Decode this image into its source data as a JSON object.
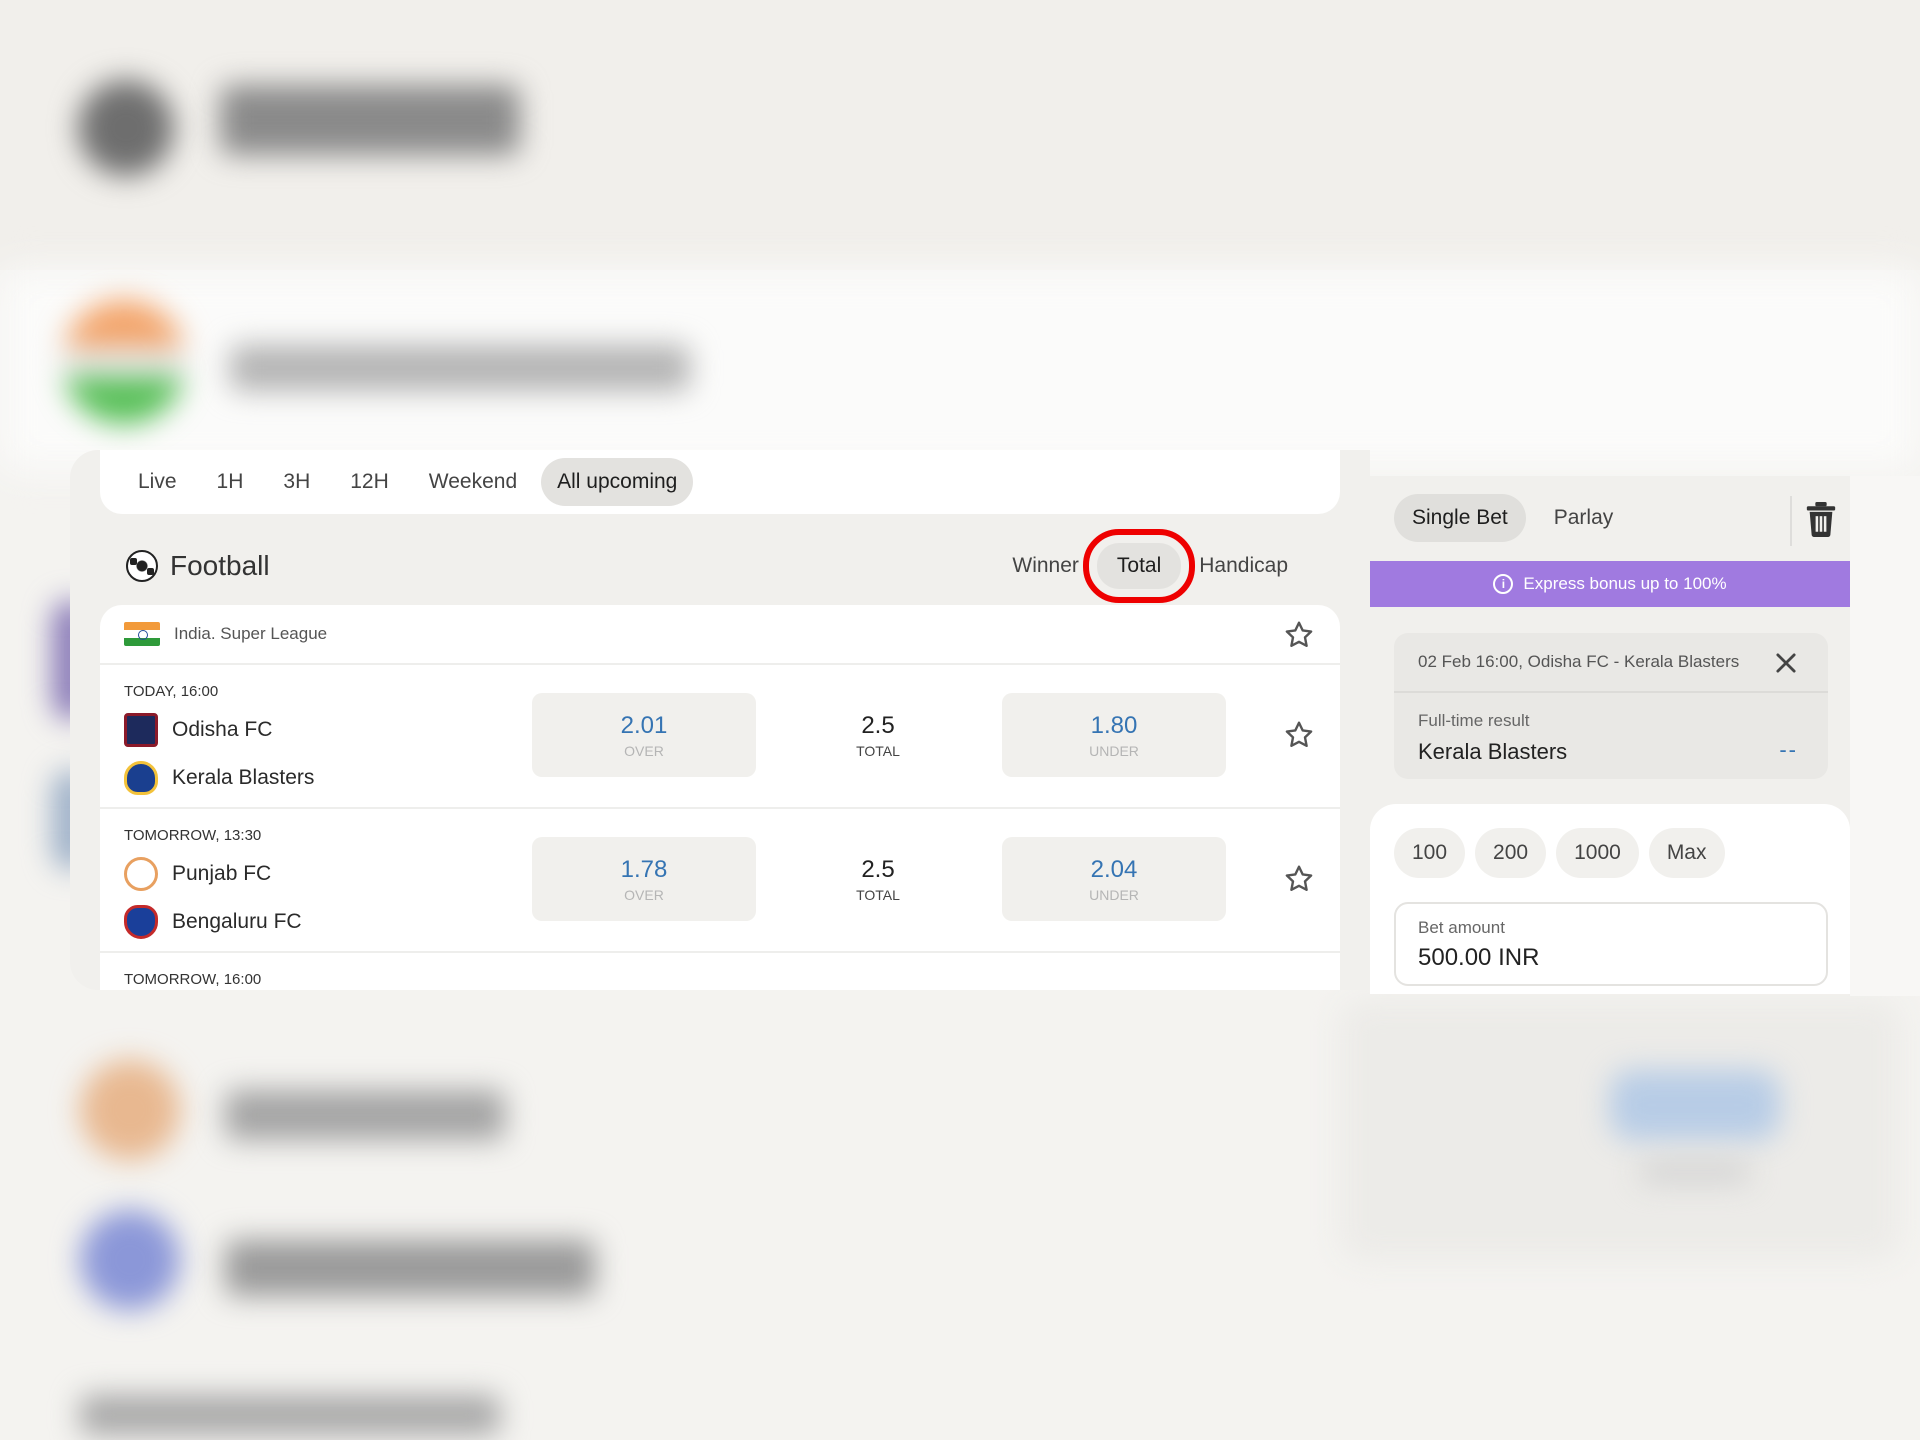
{
  "filters": [
    "Live",
    "1H",
    "3H",
    "12H",
    "Weekend",
    "All upcoming"
  ],
  "active_filter": "All upcoming",
  "sport": {
    "title": "Football",
    "icon": "soccer-ball-icon"
  },
  "market_tabs": [
    {
      "label": "Winner",
      "active": false
    },
    {
      "label": "Total",
      "active": true
    },
    {
      "label": "Handicap",
      "active": false
    }
  ],
  "league": {
    "name": "India. Super League",
    "flag": "india-flag-icon"
  },
  "matches": [
    {
      "time": "TODAY, 16:00",
      "home": "Odisha FC",
      "away": "Kerala Blasters",
      "over": {
        "value": "2.01",
        "label": "OVER"
      },
      "total": {
        "value": "2.5",
        "label": "TOTAL"
      },
      "under": {
        "value": "1.80",
        "label": "UNDER"
      }
    },
    {
      "time": "TOMORROW, 13:30",
      "home": "Punjab FC",
      "away": "Bengaluru FC",
      "over": {
        "value": "1.78",
        "label": "OVER"
      },
      "total": {
        "value": "2.5",
        "label": "TOTAL"
      },
      "under": {
        "value": "2.04",
        "label": "UNDER"
      }
    },
    {
      "time": "TOMORROW, 16:00"
    }
  ],
  "bet_slip": {
    "types": [
      {
        "label": "Single Bet",
        "active": true
      },
      {
        "label": "Parlay",
        "active": false
      }
    ],
    "express_bonus": "Express bonus up to 100%",
    "selection": {
      "event": "02 Feb 16:00, Odisha FC - Kerala Blasters",
      "market": "Full-time result",
      "pick": "Kerala Blasters",
      "odds": "--"
    },
    "quick_amounts": [
      "100",
      "200",
      "1000",
      "Max"
    ],
    "amount": {
      "label": "Bet amount",
      "value": "500.00 INR"
    }
  },
  "colors": {
    "accent_blue": "#3574b3",
    "banner_purple": "#a07ae0",
    "highlight_red": "#ee0000"
  }
}
